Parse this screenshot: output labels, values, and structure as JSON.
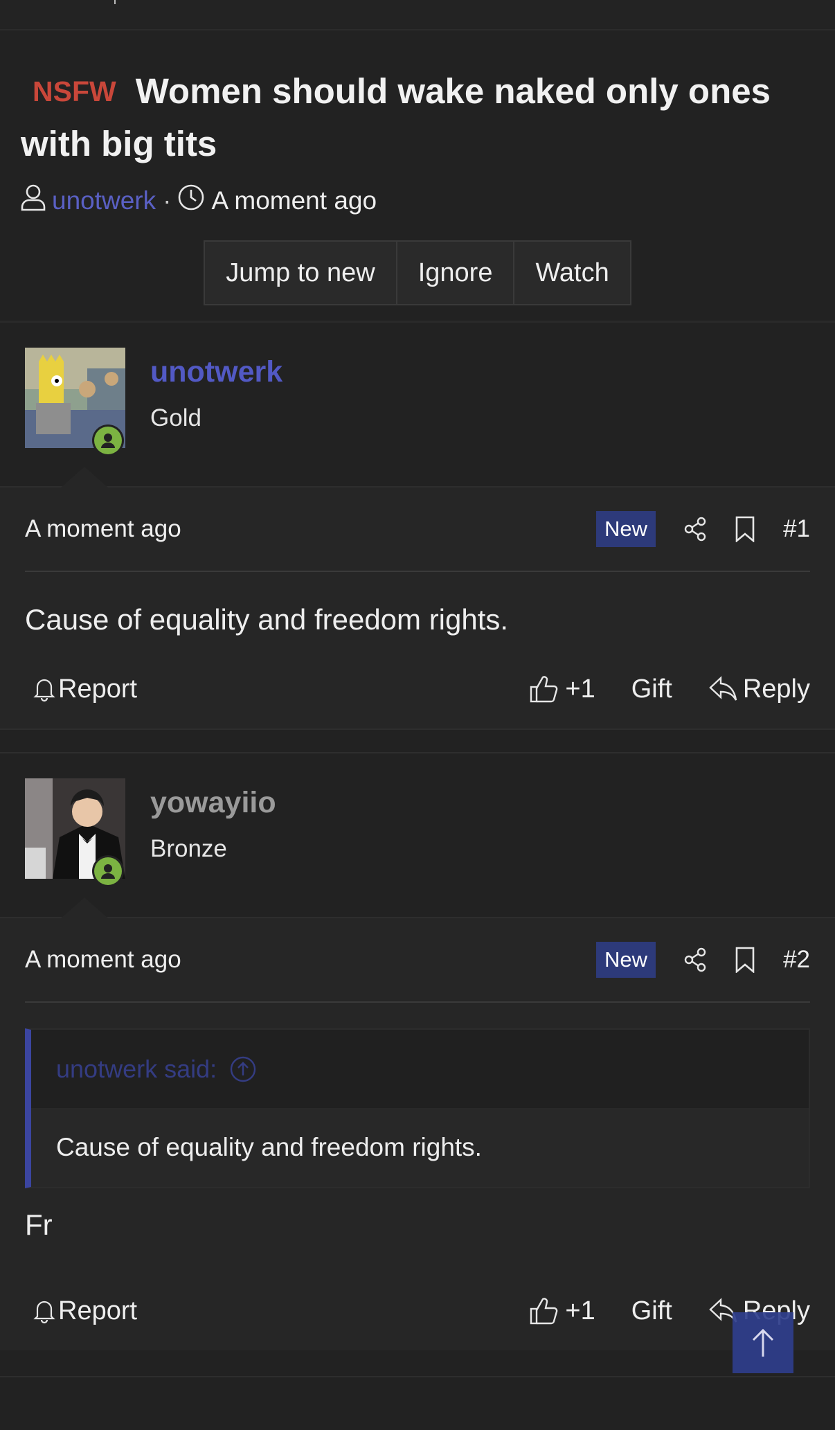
{
  "thread": {
    "prefix": "NSFW",
    "title": "Women should wake naked only ones with big tits",
    "author": "unotwerk",
    "separator": "·",
    "time": "A moment ago",
    "actions": [
      "Jump to new",
      "Ignore",
      "Watch"
    ]
  },
  "posts": [
    {
      "username": "unotwerk",
      "user_title": "Gold",
      "time": "A moment ago",
      "badge": "New",
      "number": "#1",
      "message": "Cause of equality and freedom rights.",
      "report": "Report",
      "likes": "+1",
      "gift": "Gift",
      "reply": "Reply"
    },
    {
      "username": "yowayiio",
      "user_title": "Bronze",
      "time": "A moment ago",
      "badge": "New",
      "number": "#2",
      "quote": {
        "author": "unotwerk said:",
        "text": "Cause of equality and freedom rights."
      },
      "message": "Fr",
      "report": "Report",
      "likes": "+1",
      "gift": "Gift",
      "reply": "Reply"
    }
  ],
  "icons": {
    "user": "user-icon",
    "clock": "clock-icon",
    "share": "share-icon",
    "bookmark": "bookmark-icon",
    "bell": "bell-icon",
    "thumbs_up": "thumbs-up-icon",
    "reply": "reply-arrow-icon",
    "scroll_top": "arrow-up-icon",
    "quote_jump": "circle-arrow-up-icon"
  },
  "colors": {
    "background": "#222222",
    "accent": "#5259c4",
    "nsfw": "#c9473a",
    "new_badge": "#2d3a7a",
    "online": "#7cb342"
  }
}
